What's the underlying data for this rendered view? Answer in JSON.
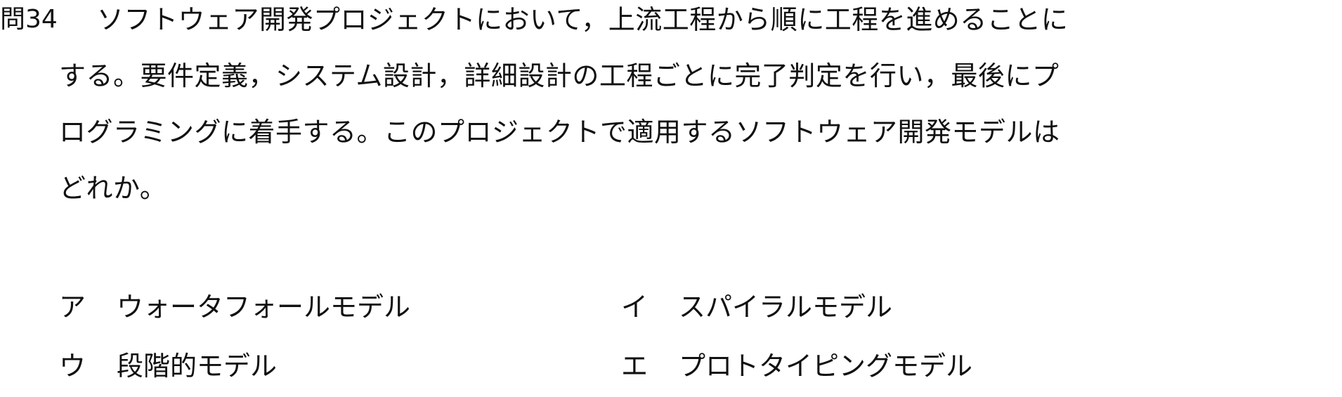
{
  "question": {
    "number": "問34",
    "lines": [
      "ソフトウェア開発プロジェクトにおいて，上流工程から順に工程を進めることに",
      "する。要件定義，システム設計，詳細設計の工程ごとに完了判定を行い，最後にプ",
      "ログラミングに着手する。このプロジェクトで適用するソフトウェア開発モデルは",
      "どれか。"
    ]
  },
  "choices": [
    {
      "letter": "ア",
      "text": "ウォータフォールモデル"
    },
    {
      "letter": "イ",
      "text": "スパイラルモデル"
    },
    {
      "letter": "ウ",
      "text": "段階的モデル"
    },
    {
      "letter": "エ",
      "text": "プロトタイピングモデル"
    }
  ]
}
